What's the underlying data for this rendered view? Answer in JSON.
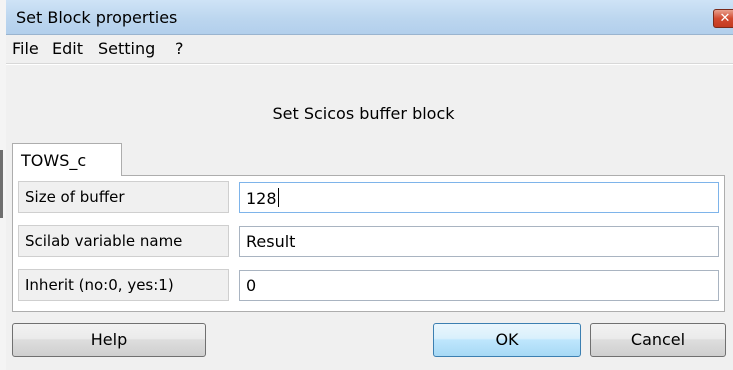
{
  "window": {
    "title": "Set Block properties",
    "close_glyph": "✕"
  },
  "menu": {
    "items": [
      "File",
      "Edit",
      "Setting",
      "?"
    ]
  },
  "header": {
    "text": "Set Scicos buffer block"
  },
  "tab": {
    "label": "TOWS_c"
  },
  "fields": [
    {
      "label": "Size of buffer",
      "value": "128"
    },
    {
      "label": "Scilab variable name",
      "value": "Result"
    },
    {
      "label": "Inherit (no:0, yes:1)",
      "value": "0"
    }
  ],
  "buttons": {
    "help": "Help",
    "ok": "OK",
    "cancel": "Cancel"
  },
  "colors": {
    "titlebar": "#bcd6ef",
    "close": "#d24a2f",
    "default_button": "#bee6fd"
  }
}
